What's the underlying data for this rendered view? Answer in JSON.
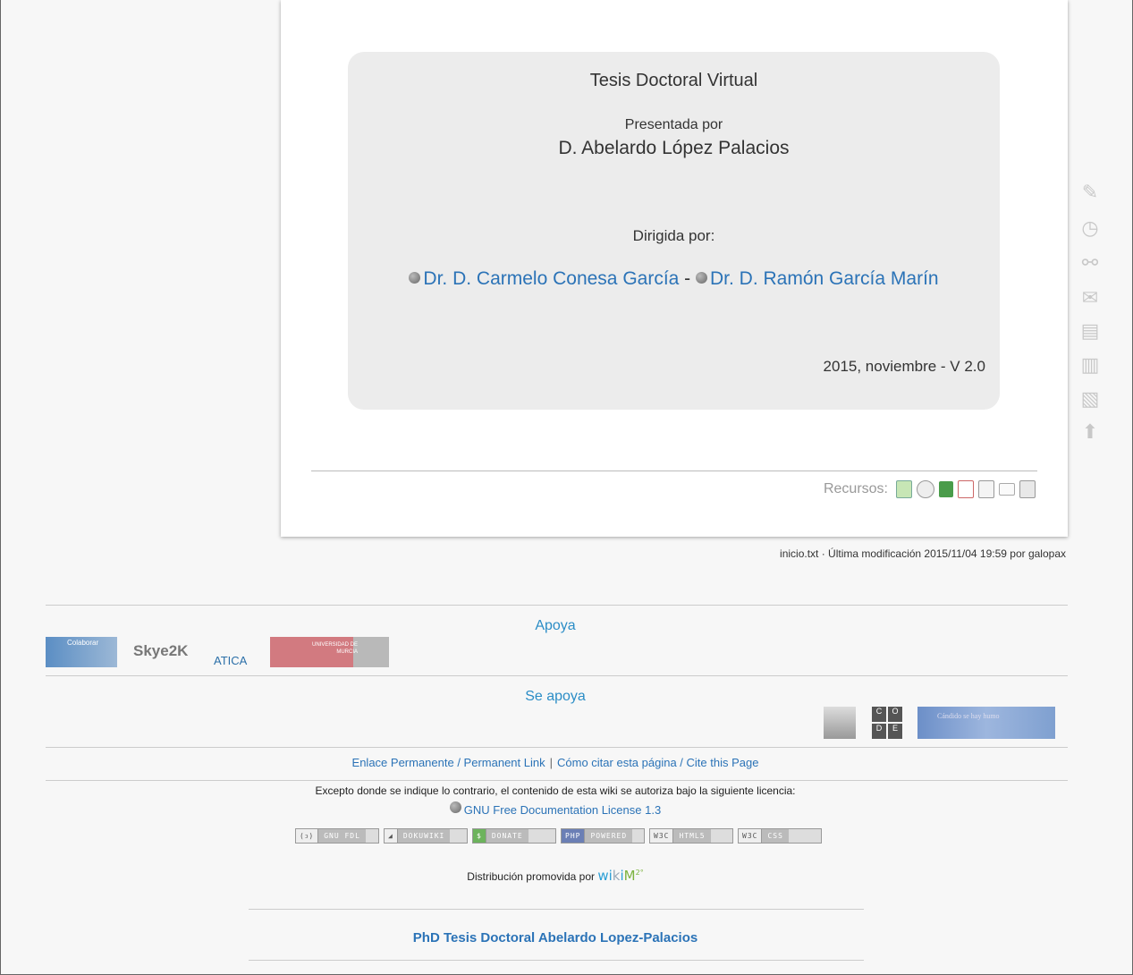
{
  "title_box": {
    "title": "Tesis Doctoral Virtual",
    "presented_by": "Presentada por",
    "author": "D. Abelardo López Palacios",
    "directed_by": "Dirigida por:",
    "director1": "Dr. D. Carmelo Conesa García",
    "separator": " - ",
    "director2": "Dr. D. Ramón García Marín",
    "date_version": "2015, noviembre - V 2.0"
  },
  "resources": {
    "label": "Recursos:",
    "icons": [
      "presentation-icon",
      "clock-icon",
      "screen-icon",
      "pdf-icon",
      "document-icon",
      "email-icon",
      "print-icon"
    ]
  },
  "last_modified": "inicio.txt · Última modificación 2015/11/04 19:59 por galopax",
  "toolbar": [
    "edit-pencil-icon",
    "history-clock-icon",
    "link-chain-icon",
    "mail-envelope-icon",
    "pdf-export-icon",
    "document-export-icon",
    "pdf-file-icon",
    "back-to-top-arrow-icon"
  ],
  "supports": {
    "title": "Apoya",
    "logos": [
      "Colaborar",
      "Skye2K",
      "ATICA",
      "UNIVERSIDAD DE MURCIA"
    ]
  },
  "supported_by": {
    "title": "Se apoya",
    "logos": [
      "portrait",
      "code",
      "Cándido se hay humo"
    ]
  },
  "footer": {
    "permalink": "Enlace Permanente / Permanent Link",
    "link_sep": "|",
    "cite": "Cómo citar esta página / Cite this Page",
    "license_text": "Excepto donde se indique lo contrario, el contenido de esta wiki se autoriza bajo la siguiente licencia:",
    "license_link": "GNU Free Documentation License 1.3",
    "badges": [
      {
        "left": "(ↄ)",
        "right": "GNU FDL"
      },
      {
        "left": "◢",
        "right": "DOKUWIKI"
      },
      {
        "left": "$",
        "right": "DONATE"
      },
      {
        "left": "PHP",
        "right": "POWERED"
      },
      {
        "left": "W3C",
        "right": "HTML5"
      },
      {
        "left": "W3C",
        "right": "CSS"
      }
    ],
    "distributed_by": "Distribución promovida por",
    "wikim_wi": "wi",
    "wikim_k": "k",
    "wikim_i": "i",
    "wikim_m": "M",
    "wikim_sup": "2°",
    "bottom_title": "PhD Tesis Doctoral Abelardo Lopez-Palacios"
  }
}
